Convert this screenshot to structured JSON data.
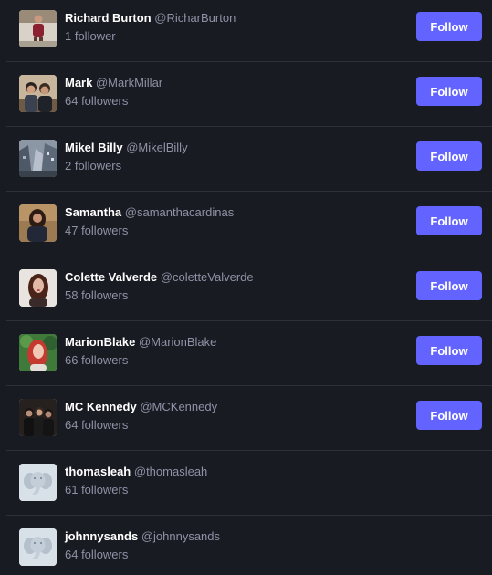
{
  "accounts": [
    {
      "display_name": "Richard Burton",
      "handle": "@RicharBurton",
      "followers": "1 follower",
      "follow_label": "Follow",
      "avatar": "photo-person-outdoor"
    },
    {
      "display_name": "Mark",
      "handle": "@MarkMillar",
      "followers": "64 followers",
      "follow_label": "Follow",
      "avatar": "photo-two-people"
    },
    {
      "display_name": "Mikel Billy",
      "handle": "@MikelBilly",
      "followers": "2 followers",
      "follow_label": "Follow",
      "avatar": "photo-city"
    },
    {
      "display_name": "Samantha",
      "handle": "@samanthacardinas",
      "followers": "47 followers",
      "follow_label": "Follow",
      "avatar": "photo-woman"
    },
    {
      "display_name": "Colette Valverde",
      "handle": "@coletteValverde",
      "followers": "58 followers",
      "follow_label": "Follow",
      "avatar": "photo-woman-portrait"
    },
    {
      "display_name": "MarionBlake",
      "handle": "@MarionBlake",
      "followers": "66 followers",
      "follow_label": "Follow",
      "avatar": "photo-redhead"
    },
    {
      "display_name": "MC Kennedy",
      "handle": "@MCKennedy",
      "followers": "64 followers",
      "follow_label": "Follow",
      "avatar": "photo-group"
    },
    {
      "display_name": "thomasleah",
      "handle": "@thomasleah",
      "followers": "61 followers",
      "avatar": "default-elephant-avatar"
    },
    {
      "display_name": "johnnysands",
      "handle": "@johnnysands",
      "followers": "64 followers",
      "avatar": "default-elephant-avatar"
    }
  ],
  "colors": {
    "background": "#191b22",
    "divider": "#2e3039",
    "accent": "#6364ff",
    "muted_text": "#8f92a6"
  }
}
